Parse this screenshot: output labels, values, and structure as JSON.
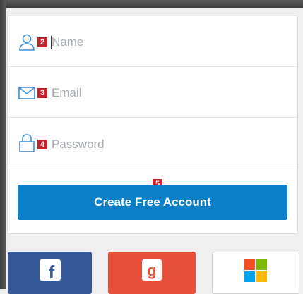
{
  "form": {
    "name": {
      "placeholder": "Name",
      "value": "",
      "badge": "2",
      "icon": "user-icon"
    },
    "email": {
      "placeholder": "Email",
      "value": "",
      "badge": "3",
      "icon": "envelope-icon"
    },
    "password": {
      "placeholder": "Password",
      "value": "",
      "badge": "4",
      "icon": "lock-icon"
    },
    "submit": {
      "label": "Create Free Account",
      "badge": "5"
    }
  },
  "social": [
    {
      "provider": "facebook",
      "glyph": "f",
      "icon": "facebook-icon",
      "color": "#365899"
    },
    {
      "provider": "google",
      "glyph": "g",
      "icon": "google-icon",
      "color": "#e6503c"
    },
    {
      "provider": "microsoft",
      "icon": "microsoft-icon",
      "color": "#ffffff"
    }
  ],
  "colors": {
    "accent": "#0b7fc7",
    "badge": "#c8202a",
    "icon": "#3f8fd8",
    "placeholder": "#a7acb0",
    "ms_tiles": [
      "#f25022",
      "#7fba00",
      "#00a4ef",
      "#ffb900"
    ]
  }
}
